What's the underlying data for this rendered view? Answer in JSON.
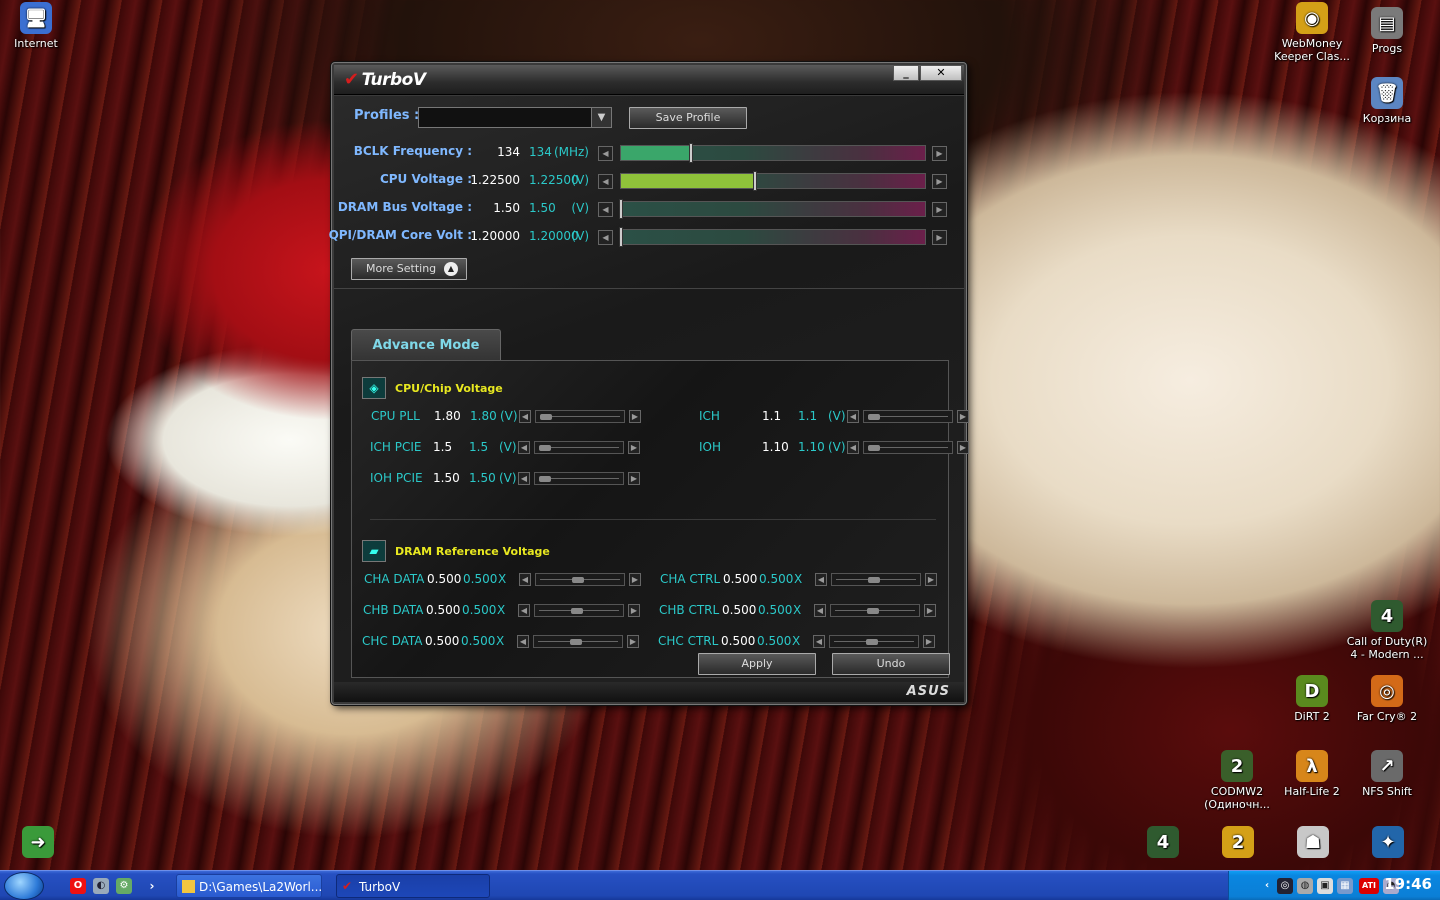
{
  "desktop": {
    "icons": [
      {
        "label": "Internet",
        "glyph": "🖥",
        "bg": "#3b6fd1"
      },
      {
        "label": "WebMoney Keeper Clas...",
        "glyph": "◉",
        "bg": "#d4a017"
      },
      {
        "label": "Progs",
        "glyph": "▤",
        "bg": "#7a7a7a"
      },
      {
        "label": "Корзина",
        "glyph": "🗑",
        "bg": "#5c86c2"
      },
      {
        "label": "Call of Duty(R) 4 - Modern ...",
        "glyph": "4",
        "bg": "#2f5a2f"
      },
      {
        "label": "DiRT 2",
        "glyph": "D",
        "bg": "#5a8a1e"
      },
      {
        "label": "Far Cry® 2",
        "glyph": "◎",
        "bg": "#d36a18"
      },
      {
        "label": "CODMW2 (Одиночн...",
        "glyph": "2",
        "bg": "#3a5f2a"
      },
      {
        "label": "Half-Life 2",
        "glyph": "λ",
        "bg": "#d7861a"
      },
      {
        "label": "NFS Shift",
        "glyph": "↗",
        "bg": "#6a6a6a"
      }
    ]
  },
  "window": {
    "title": "TurboV",
    "controls": {
      "minimize": "_",
      "close": "✕"
    },
    "profiles_label": "Profiles :",
    "profile_value": "",
    "save_profile": "Save Profile",
    "more_setting": "More Setting",
    "main_settings": [
      {
        "label": "BCLK Frequency :",
        "value": "134",
        "display": "134",
        "unit": "(MHz)",
        "level": 0.23,
        "fill": "#3aa66a"
      },
      {
        "label": "CPU Voltage :",
        "value": "1.22500",
        "display": "1.22500",
        "unit": "(V)",
        "level": 0.44,
        "fill": "#8fc23a"
      },
      {
        "label": "DRAM Bus Voltage :",
        "value": "1.50",
        "display": "1.50",
        "unit": "(V)",
        "level": 0.0,
        "fill": "#3aa66a"
      },
      {
        "label": "QPI/DRAM Core Volt :",
        "value": "1.20000",
        "display": "1.20000",
        "unit": "(V)",
        "level": 0.0,
        "fill": "#3aa66a"
      }
    ],
    "advance_tab": "Advance Mode",
    "cpu_chip_section": {
      "title": "CPU/Chip Voltage",
      "items": [
        {
          "label": "CPU PLL",
          "value": "1.80",
          "display": "1.80",
          "unit": "(V)",
          "level": 0.0
        },
        {
          "label": "ICH",
          "value": "1.1",
          "display": "1.1",
          "unit": "(V)",
          "level": 0.0
        },
        {
          "label": "ICH PCIE",
          "value": "1.5",
          "display": "1.5",
          "unit": "(V)",
          "level": 0.0
        },
        {
          "label": "IOH",
          "value": "1.10",
          "display": "1.10",
          "unit": "(V)",
          "level": 0.0
        },
        {
          "label": "IOH PCIE",
          "value": "1.50",
          "display": "1.50",
          "unit": "(V)",
          "level": 0.0
        }
      ]
    },
    "dram_ref_section": {
      "title": "DRAM Reference Voltage",
      "items": [
        {
          "label": "CHA DATA",
          "value": "0.500",
          "display": "0.500",
          "unit": "X",
          "level": 0.45
        },
        {
          "label": "CHA CTRL",
          "value": "0.500",
          "display": "0.500",
          "unit": "X",
          "level": 0.45
        },
        {
          "label": "CHB DATA",
          "value": "0.500",
          "display": "0.500",
          "unit": "X",
          "level": 0.45
        },
        {
          "label": "CHB CTRL",
          "value": "0.500",
          "display": "0.500",
          "unit": "X",
          "level": 0.45
        },
        {
          "label": "CHC DATA",
          "value": "0.500",
          "display": "0.500",
          "unit": "X",
          "level": 0.45
        },
        {
          "label": "CHC CTRL",
          "value": "0.500",
          "display": "0.500",
          "unit": "X",
          "level": 0.45
        }
      ]
    },
    "apply": "Apply",
    "undo": "Undo",
    "brand": "ASUS"
  },
  "taskbar": {
    "tasks": [
      {
        "label": "D:\\Games\\La2Worl...",
        "active": false
      },
      {
        "label": "TurboV",
        "active": true
      }
    ],
    "clock": "19:46"
  }
}
